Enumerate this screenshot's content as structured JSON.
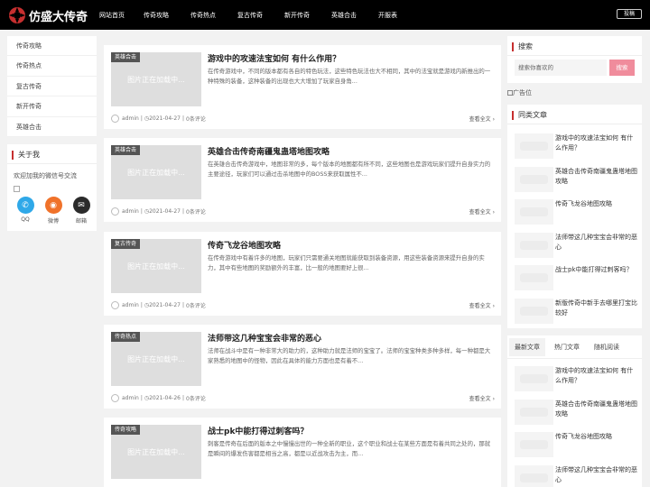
{
  "site": {
    "name": "仿盛大传奇",
    "post_label": "投稿",
    "accent": "#c62f2f"
  },
  "nav": [
    "网站首页",
    "传奇攻略",
    "传奇热点",
    "复古传奇",
    "新开传奇",
    "英雄合击",
    "开服表"
  ],
  "left_menu": [
    "传奇攻略",
    "传奇热点",
    "复古传奇",
    "新开传奇",
    "英雄合击"
  ],
  "about": {
    "title": "关于我",
    "text": "欢迎加我的微信号交流",
    "social": [
      {
        "label": "QQ",
        "icon": "qq-icon",
        "color": "#2fa8e8"
      },
      {
        "label": "微博",
        "icon": "weibo-icon",
        "color": "#f0722a"
      },
      {
        "label": "邮箱",
        "icon": "mail-icon",
        "color": "#2b2b2b"
      }
    ]
  },
  "thumb_text": "图片正在加载中...",
  "read_more": "查看全文",
  "posts": [
    {
      "cat": "英雄合击",
      "title": "游戏中的攻速法宝如何 有什么作用？",
      "excerpt": "在传奇游戏中，不同的版本都有各自的特色玩法，这些特色玩法也大不相同，其中的法宝就是游戏内新推出的一种特殊的装备，这种装备的出现也大大增加了玩家自身角...",
      "author": "admin",
      "date": "2021-04-27",
      "comments": "0条评论"
    },
    {
      "cat": "英雄合击",
      "title": "英雄合击传奇南疆鬼蛊塔地图攻略",
      "excerpt": "在英雄合击传奇游戏中，地图非常的多，每个版本的地图都有所不同，这些地图也是游戏玩家们提升自身实力的主要途径，玩家们可以通过击杀地图中的BOSS来获取属性不...",
      "author": "admin",
      "date": "2021-04-27",
      "comments": "0条评论"
    },
    {
      "cat": "复古传奇",
      "title": "传奇飞龙谷地图攻略",
      "excerpt": "在传奇游戏中有着许多的地图，玩家们只需要通关地图就能获取到装备资源，用这些装备资源来提升自身的实力，其中有些地图的奖励额外的丰富，比一般的地图要好上很...",
      "author": "admin",
      "date": "2021-04-27",
      "comments": "0条评论"
    },
    {
      "cat": "传奇热点",
      "title": "法师带这几种宝宝会非常的恶心",
      "excerpt": "法师在战斗中是有一种非常大的助力的，这种助力就是法师的宝宝了。法师的宝宝种类多种多样，每一种都是大家熟悉的地图中的怪物，因此在具体的能力方面也是有着不...",
      "author": "admin",
      "date": "2021-04-26",
      "comments": "0条评论"
    },
    {
      "cat": "传奇攻略",
      "title": "战士pk中能打得过刺客吗？",
      "excerpt": "刺客是传奇在后面的版本之中慢慢出世的一种全新的职业，这个职业和战士在某些方面是有着共同之处的，那就是瞬间的爆发伤害都是相当之高，都是以近战攻击为主，而...",
      "author": "",
      "date": "",
      "comments": ""
    }
  ],
  "search": {
    "title": "搜索",
    "placeholder": "搜索你喜欢的",
    "button": "搜索"
  },
  "ad_text": "广告位",
  "same_category": {
    "title": "同类文章",
    "items": [
      "游戏中的攻速法宝如何 有什么作用？",
      "英雄合击传奇南疆鬼蛊塔地图攻略",
      "传奇飞龙谷地图攻略",
      "法师带这几种宝宝会非常的恶心",
      "战士pk中能打得过刺客吗？",
      "新版传奇中新手去哪里打宝比较好"
    ]
  },
  "tabs": {
    "labels": [
      "最新文章",
      "热门文章",
      "随机阅读"
    ],
    "items": [
      "游戏中的攻速法宝如何 有什么作用？",
      "英雄合击传奇南疆鬼蛊塔地图攻略",
      "传奇飞龙谷地图攻略",
      "法师带这几种宝宝会非常的恶心"
    ]
  }
}
